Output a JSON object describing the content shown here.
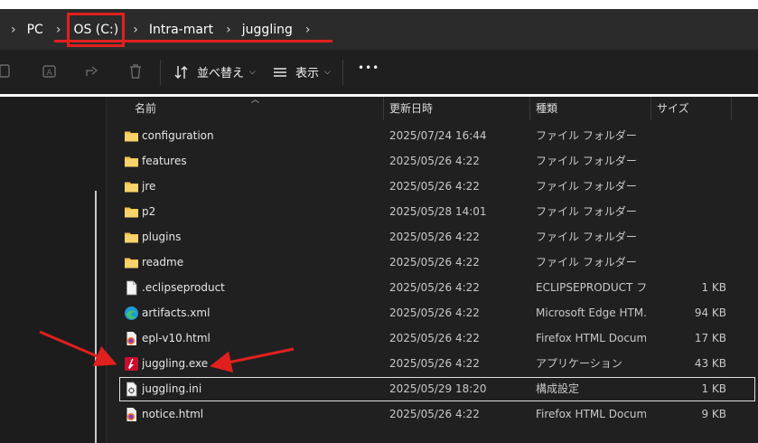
{
  "breadcrumb": {
    "items": [
      {
        "label": "PC",
        "highlighted": false
      },
      {
        "label": "OS (C:)",
        "highlighted": true
      },
      {
        "label": "Intra-mart",
        "highlighted": false
      },
      {
        "label": "juggling",
        "highlighted": false
      }
    ]
  },
  "toolbar": {
    "sort_label": "並べ替え",
    "view_label": "表示",
    "more_label": "•••",
    "icons": [
      "copy-icon",
      "rename-icon",
      "share-icon",
      "delete-icon",
      "sort-icon",
      "view-icon",
      "more-icon"
    ]
  },
  "columns": {
    "name": "名前",
    "date": "更新日時",
    "type": "種類",
    "size": "サイズ"
  },
  "files": [
    {
      "name": "configuration",
      "date": "2025/07/24 16:44",
      "type": "ファイル フォルダー",
      "size": "",
      "icon": "folder-icon"
    },
    {
      "name": "features",
      "date": "2025/05/26 4:22",
      "type": "ファイル フォルダー",
      "size": "",
      "icon": "folder-icon"
    },
    {
      "name": "jre",
      "date": "2025/05/26 4:22",
      "type": "ファイル フォルダー",
      "size": "",
      "icon": "folder-icon"
    },
    {
      "name": "p2",
      "date": "2025/05/28 14:01",
      "type": "ファイル フォルダー",
      "size": "",
      "icon": "folder-icon"
    },
    {
      "name": "plugins",
      "date": "2025/05/26 4:22",
      "type": "ファイル フォルダー",
      "size": "",
      "icon": "folder-icon"
    },
    {
      "name": "readme",
      "date": "2025/05/26 4:22",
      "type": "ファイル フォルダー",
      "size": "",
      "icon": "folder-icon"
    },
    {
      "name": ".eclipseproduct",
      "date": "2025/05/26 4:22",
      "type": "ECLIPSEPRODUCT ファ...",
      "size": "1 KB",
      "icon": "file-icon"
    },
    {
      "name": "artifacts.xml",
      "date": "2025/05/26 4:22",
      "type": "Microsoft Edge HTM...",
      "size": "94 KB",
      "icon": "edge-icon"
    },
    {
      "name": "epl-v10.html",
      "date": "2025/05/26 4:22",
      "type": "Firefox HTML Docum...",
      "size": "17 KB",
      "icon": "firefox-icon"
    },
    {
      "name": "juggling.exe",
      "date": "2025/05/26 4:22",
      "type": "アプリケーション",
      "size": "43 KB",
      "icon": "exe-icon"
    },
    {
      "name": "juggling.ini",
      "date": "2025/05/29 18:20",
      "type": "構成設定",
      "size": "1 KB",
      "icon": "ini-icon",
      "selected": true
    },
    {
      "name": "notice.html",
      "date": "2025/05/26 4:22",
      "type": "Firefox HTML Docum...",
      "size": "9 KB",
      "icon": "firefox-icon"
    }
  ],
  "annotations": {
    "color": "#e0201f"
  }
}
